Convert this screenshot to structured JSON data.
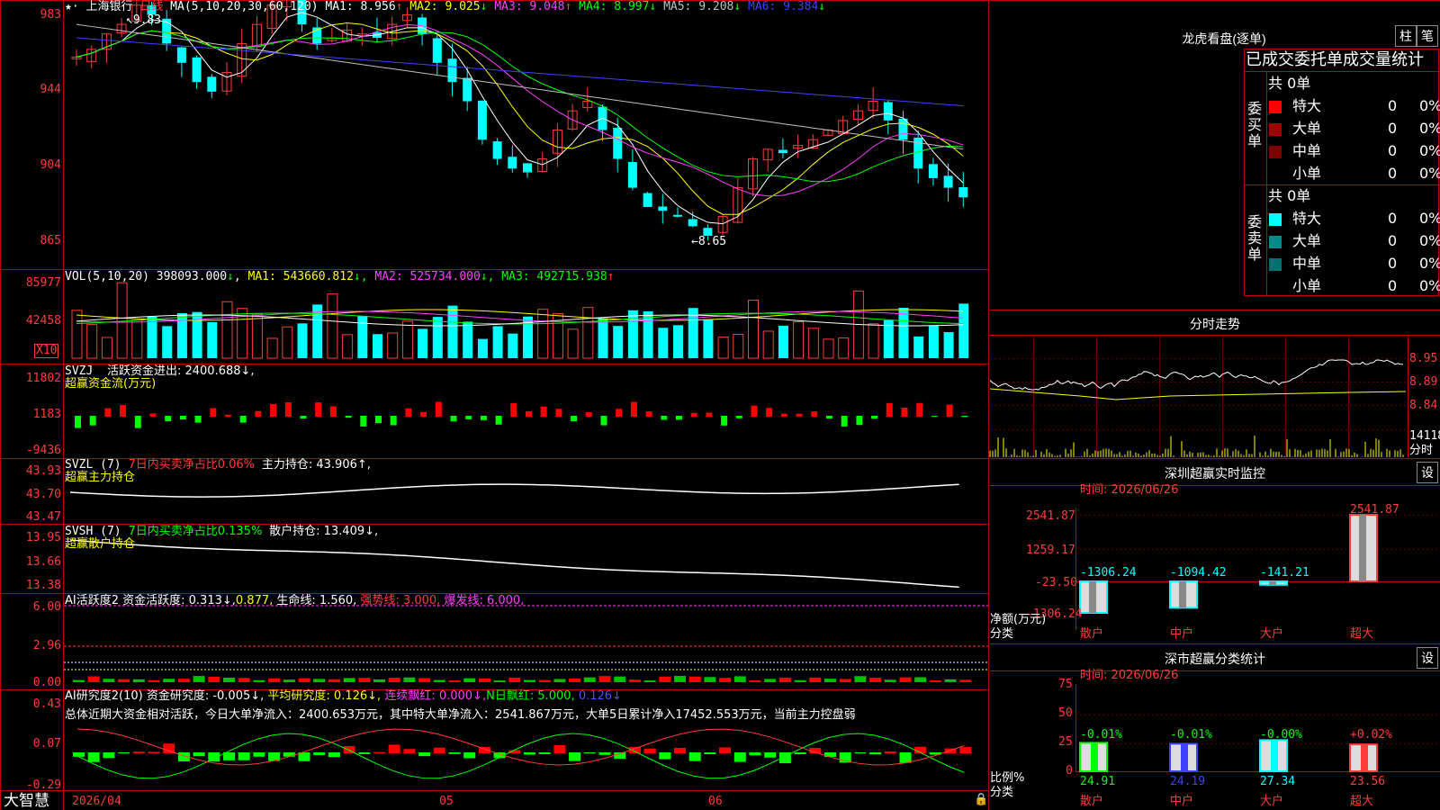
{
  "stock": {
    "name": "上海银行",
    "period": "日线",
    "ma_label": "MA(5,10,20,30,60,120)",
    "ma_values": [
      {
        "label": "MA1:",
        "value": "8.956",
        "arrow": "↑",
        "color": "#ffffff"
      },
      {
        "label": "MA2:",
        "value": "9.025",
        "arrow": "↓",
        "color": "#ffff00"
      },
      {
        "label": "MA3:",
        "value": "9.048",
        "arrow": "↑",
        "color": "#ff40ff"
      },
      {
        "label": "MA4:",
        "value": "8.997",
        "arrow": "↓",
        "color": "#00ff00"
      },
      {
        "label": "MA5:",
        "value": "9.208",
        "arrow": "↓",
        "color": "#c0c0c0"
      },
      {
        "label": "MA6:",
        "value": "9.384",
        "arrow": "↓",
        "color": "#4040ff"
      }
    ],
    "high_mark": "9.83",
    "low_mark": "←8.65",
    "y_ticks": [
      "983",
      "944",
      "904",
      "865"
    ]
  },
  "vol": {
    "label": "VOL(5,10,20)",
    "value": "398093.000",
    "arrow": "↓",
    "ma1": "MA1: 543660.812",
    "ma2": "MA2: 525734.000",
    "ma3": "MA3: 492715.938",
    "y_ticks": [
      "85977",
      "42458"
    ],
    "multiplier": "X10"
  },
  "svzj": {
    "label": "SVZJ",
    "desc": "活跃资金进出: 2400.688↓,",
    "sub": "超赢资金流(万元)",
    "y_ticks": [
      "11802",
      "1183",
      "-9436"
    ]
  },
  "svzl": {
    "label": "SVZL  (7)",
    "pct": "7日内买卖净占比0.06%",
    "hold": "主力持仓: 43.906↑,",
    "sub": "超赢主力持仓",
    "y_ticks": [
      "43.93",
      "43.70",
      "43.47"
    ]
  },
  "svsh": {
    "label": "SVSH  (7)",
    "pct": "7日内买卖净占比0.135%",
    "hold": "散户持仓: 13.409↓,",
    "sub": "超赢散户持仓",
    "y_ticks": [
      "13.95",
      "13.66",
      "13.38"
    ]
  },
  "ai1": {
    "label": "AI活跃度2",
    "a": "资金活跃度: 0.313↓,",
    "b": "0.877,",
    "c": "生命线: 1.560,",
    "d": "强势线: 3.000,",
    "e": "爆发线: 6.000,",
    "y_ticks": [
      "6.00",
      "2.96",
      "0.00"
    ]
  },
  "ai2": {
    "label": "AI研究度2(10)",
    "a": "资金研究度: -0.005↓,",
    "b": "平均研究度: 0.126↓,",
    "c": "连续飘红: 0.000↓,",
    "d": "N日飘红: 5.000,",
    "e": "0.126↓",
    "summary": "总体近期大资金相对活跃，今日大单净流入：2400.653万元，其中特大单净流入：2541.867万元，大单5日累计净入17452.553万元，当前主力控盘弱",
    "y_ticks": [
      "0.43",
      "0.07",
      "-0.29"
    ]
  },
  "bottom": {
    "brand": "大智慧",
    "dates": [
      "2026/04",
      "05",
      "06"
    ]
  },
  "dragon": {
    "title": "龙虎看盘(逐单)",
    "btn_zhu": "柱",
    "btn_bi": "笔",
    "header": "已成交委托单成交量统计",
    "buy_total": "共 0单",
    "buy_label": "委买单",
    "sell_total": "共 0单",
    "sell_label": "委卖单",
    "rows": [
      {
        "name": "特大",
        "qty": "0",
        "pct": "0%"
      },
      {
        "name": "大单",
        "qty": "0",
        "pct": "0%"
      },
      {
        "name": "中单",
        "qty": "0",
        "pct": "0%"
      },
      {
        "name": "小单",
        "qty": "0",
        "pct": "0%"
      }
    ],
    "buy_colors": [
      "#ff0000",
      "#a00000",
      "#800000",
      "#000000"
    ],
    "sell_colors": [
      "#00ffff",
      "#008b8b",
      "#007070",
      "#000000"
    ]
  },
  "intraday": {
    "title": "分时走势",
    "y_ticks": [
      "8.95",
      "8.89",
      "8.84"
    ],
    "vol_tick": "14118",
    "vol_label": "分时"
  },
  "monitor": {
    "title": "深圳超赢实时监控",
    "btn": "设",
    "time": "时间: 2026/06/26",
    "y_ticks": [
      "2541.87",
      "1259.17",
      "-23.50",
      "-1306.24"
    ],
    "ylabel": "净额(万元)",
    "xlabel": "分类",
    "categories": [
      "散户",
      "中户",
      "大户",
      "超大"
    ],
    "values": [
      "-1306.24",
      "-1094.42",
      "-141.21",
      "2541.87"
    ]
  },
  "classify": {
    "title": "深市超赢分类统计",
    "btn": "设",
    "time": "时间: 2026/06/26",
    "y_ticks": [
      "75",
      "50",
      "25",
      "0"
    ],
    "ylabel": "比例%",
    "xlabel": "分类",
    "categories": [
      "散户",
      "中户",
      "大户",
      "超大"
    ],
    "changes": [
      "-0.01%",
      "-0.01%",
      "-0.00%",
      "+0.02%"
    ],
    "values": [
      "24.91",
      "24.19",
      "27.34",
      "23.56"
    ]
  },
  "chart_data": {
    "type": "table",
    "title": "深圳超赢实时监控",
    "categories": [
      "散户",
      "中户",
      "大户",
      "超大"
    ],
    "series": [
      {
        "name": "净额(万元)",
        "values": [
          -1306.24,
          -1094.42,
          -141.21,
          2541.87
        ]
      },
      {
        "name": "比例%",
        "values": [
          24.91,
          24.19,
          27.34,
          23.56
        ]
      }
    ]
  }
}
